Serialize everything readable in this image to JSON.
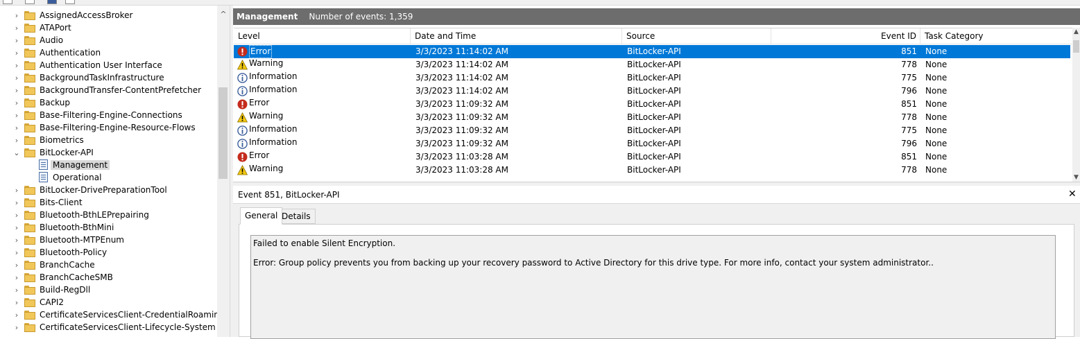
{
  "tree": {
    "items": [
      {
        "label": "AssignedAccessBroker",
        "type": "folder",
        "expanded": false
      },
      {
        "label": "ATAPort",
        "type": "folder",
        "expanded": false
      },
      {
        "label": "Audio",
        "type": "folder",
        "expanded": false
      },
      {
        "label": "Authentication",
        "type": "folder",
        "expanded": false
      },
      {
        "label": "Authentication User Interface",
        "type": "folder",
        "expanded": false
      },
      {
        "label": "BackgroundTaskInfrastructure",
        "type": "folder",
        "expanded": false
      },
      {
        "label": "BackgroundTransfer-ContentPrefetcher",
        "type": "folder",
        "expanded": false
      },
      {
        "label": "Backup",
        "type": "folder",
        "expanded": false
      },
      {
        "label": "Base-Filtering-Engine-Connections",
        "type": "folder",
        "expanded": false
      },
      {
        "label": "Base-Filtering-Engine-Resource-Flows",
        "type": "folder",
        "expanded": false
      },
      {
        "label": "Biometrics",
        "type": "folder",
        "expanded": false
      },
      {
        "label": "BitLocker-API",
        "type": "folder",
        "expanded": true
      },
      {
        "label": "Management",
        "type": "log",
        "selected": true
      },
      {
        "label": "Operational",
        "type": "log"
      },
      {
        "label": "BitLocker-DrivePreparationTool",
        "type": "folder",
        "expanded": false
      },
      {
        "label": "Bits-Client",
        "type": "folder",
        "expanded": false
      },
      {
        "label": "Bluetooth-BthLEPrepairing",
        "type": "folder",
        "expanded": false
      },
      {
        "label": "Bluetooth-BthMini",
        "type": "folder",
        "expanded": false
      },
      {
        "label": "Bluetooth-MTPEnum",
        "type": "folder",
        "expanded": false
      },
      {
        "label": "Bluetooth-Policy",
        "type": "folder",
        "expanded": false
      },
      {
        "label": "BranchCache",
        "type": "folder",
        "expanded": false
      },
      {
        "label": "BranchCacheSMB",
        "type": "folder",
        "expanded": false
      },
      {
        "label": "Build-RegDll",
        "type": "folder",
        "expanded": false
      },
      {
        "label": "CAPI2",
        "type": "folder",
        "expanded": false
      },
      {
        "label": "CertificateServicesClient-CredentialRoaming",
        "type": "folder",
        "expanded": false
      },
      {
        "label": "CertificateServicesClient-Lifecycle-System",
        "type": "folder",
        "expanded": false
      }
    ]
  },
  "header": {
    "title": "Management",
    "count_text": "Number of events: 1,359"
  },
  "grid": {
    "columns": [
      "Level",
      "Date and Time",
      "Source",
      "Event ID",
      "Task Category"
    ],
    "rows": [
      {
        "level": "Error",
        "icon": "error-icon",
        "datetime": "3/3/2023 11:14:02 AM",
        "source": "BitLocker-API",
        "event_id": "851",
        "task": "None",
        "selected": true
      },
      {
        "level": "Warning",
        "icon": "warning-icon",
        "datetime": "3/3/2023 11:14:02 AM",
        "source": "BitLocker-API",
        "event_id": "778",
        "task": "None"
      },
      {
        "level": "Information",
        "icon": "info-icon",
        "datetime": "3/3/2023 11:14:02 AM",
        "source": "BitLocker-API",
        "event_id": "775",
        "task": "None"
      },
      {
        "level": "Information",
        "icon": "info-icon",
        "datetime": "3/3/2023 11:14:02 AM",
        "source": "BitLocker-API",
        "event_id": "796",
        "task": "None"
      },
      {
        "level": "Error",
        "icon": "error-icon",
        "datetime": "3/3/2023 11:09:32 AM",
        "source": "BitLocker-API",
        "event_id": "851",
        "task": "None"
      },
      {
        "level": "Warning",
        "icon": "warning-icon",
        "datetime": "3/3/2023 11:09:32 AM",
        "source": "BitLocker-API",
        "event_id": "778",
        "task": "None"
      },
      {
        "level": "Information",
        "icon": "info-icon",
        "datetime": "3/3/2023 11:09:32 AM",
        "source": "BitLocker-API",
        "event_id": "775",
        "task": "None"
      },
      {
        "level": "Information",
        "icon": "info-icon",
        "datetime": "3/3/2023 11:09:32 AM",
        "source": "BitLocker-API",
        "event_id": "796",
        "task": "None"
      },
      {
        "level": "Error",
        "icon": "error-icon",
        "datetime": "3/3/2023 11:03:28 AM",
        "source": "BitLocker-API",
        "event_id": "851",
        "task": "None"
      },
      {
        "level": "Warning",
        "icon": "warning-icon",
        "datetime": "3/3/2023 11:03:28 AM",
        "source": "BitLocker-API",
        "event_id": "778",
        "task": "None"
      }
    ]
  },
  "detail": {
    "title": "Event 851, BitLocker-API",
    "close_label": "✕",
    "tabs": [
      "General",
      "Details"
    ],
    "active_tab": "General",
    "message_lines": [
      "Failed to enable Silent Encryption.",
      "Error: Group policy prevents you from backing up your recovery password to Active Directory for this drive type. For more info, contact your system administrator.."
    ]
  },
  "colors": {
    "selection": "#0078d7",
    "header_bar": "#6d6d6d",
    "error": "#c42b1c",
    "warning": "#f2c811",
    "info": "#3b5e9b"
  }
}
